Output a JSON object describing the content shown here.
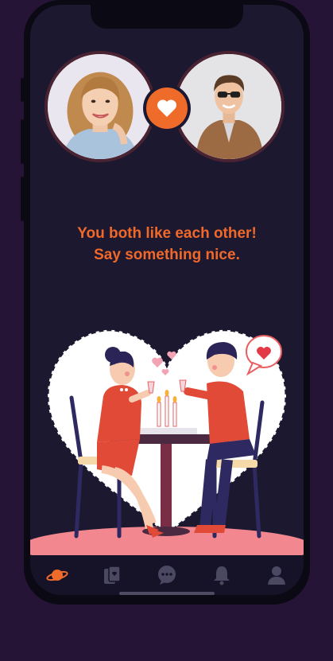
{
  "screen": "match",
  "colors": {
    "background": "#261436",
    "screen": "#1c1830",
    "accent": "#ee6b2a",
    "tabbar": "#161328",
    "tab_inactive": "#4b4862"
  },
  "match": {
    "message_line1": "You both like each other!",
    "message_line2": "Say something nice."
  },
  "tabs": [
    {
      "icon": "planet-icon",
      "active": true
    },
    {
      "icon": "cards-icon",
      "active": false
    },
    {
      "icon": "chat-icon",
      "active": false
    },
    {
      "icon": "bell-icon",
      "active": false
    },
    {
      "icon": "profile-icon",
      "active": false
    }
  ]
}
